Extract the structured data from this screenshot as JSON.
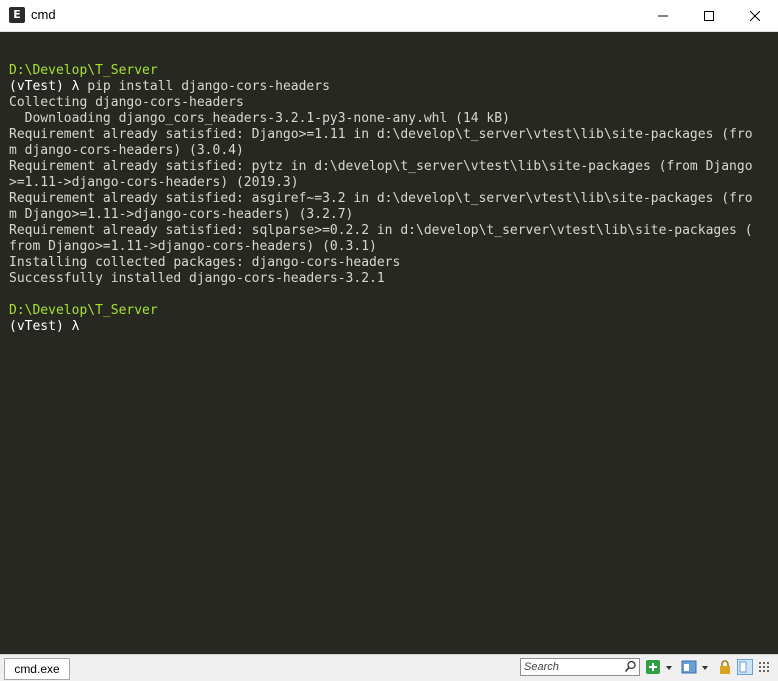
{
  "window": {
    "title": "cmd",
    "app_icon_glyph": "E",
    "app_icon": "console-emulator-icon",
    "controls": [
      "minimize-icon",
      "maximize-icon",
      "close-icon"
    ]
  },
  "terminal": {
    "background": "#272822",
    "path_color": "#a6e22e",
    "lines": [
      {
        "text": "",
        "kind": "blank"
      },
      {
        "text": "D:\\Develop\\T_Server",
        "kind": "path"
      },
      {
        "env": "(vTest)",
        "lambda": "λ",
        "cmd": " pip install django-cors-headers",
        "kind": "prompt"
      },
      {
        "text": "Collecting django-cors-headers",
        "kind": "output"
      },
      {
        "text": "  Downloading django_cors_headers-3.2.1-py3-none-any.whl (14 kB)",
        "kind": "output"
      },
      {
        "text": "Requirement already satisfied: Django>=1.11 in d:\\develop\\t_server\\vtest\\lib\\site-packages (fro",
        "kind": "output"
      },
      {
        "text": "m django-cors-headers) (3.0.4)",
        "kind": "output"
      },
      {
        "text": "Requirement already satisfied: pytz in d:\\develop\\t_server\\vtest\\lib\\site-packages (from Django",
        "kind": "output"
      },
      {
        "text": ">=1.11->django-cors-headers) (2019.3)",
        "kind": "output"
      },
      {
        "text": "Requirement already satisfied: asgiref~=3.2 in d:\\develop\\t_server\\vtest\\lib\\site-packages (fro",
        "kind": "output"
      },
      {
        "text": "m Django>=1.11->django-cors-headers) (3.2.7)",
        "kind": "output"
      },
      {
        "text": "Requirement already satisfied: sqlparse>=0.2.2 in d:\\develop\\t_server\\vtest\\lib\\site-packages (",
        "kind": "output"
      },
      {
        "text": "from Django>=1.11->django-cors-headers) (0.3.1)",
        "kind": "output"
      },
      {
        "text": "Installing collected packages: django-cors-headers",
        "kind": "output"
      },
      {
        "text": "Successfully installed django-cors-headers-3.2.1",
        "kind": "output"
      },
      {
        "text": "",
        "kind": "blank"
      },
      {
        "text": "D:\\Develop\\T_Server",
        "kind": "path"
      },
      {
        "env": "(vTest)",
        "lambda": "λ",
        "cmd": "",
        "kind": "prompt"
      }
    ]
  },
  "statusbar": {
    "tab_label": "cmd.exe",
    "search_placeholder": "Search",
    "icons": [
      "search-icon",
      "new-console-icon",
      "dropdown-icon",
      "window-layout-icon",
      "dropdown-icon",
      "lock-icon",
      "split-view-icon",
      "grid-icon"
    ]
  }
}
